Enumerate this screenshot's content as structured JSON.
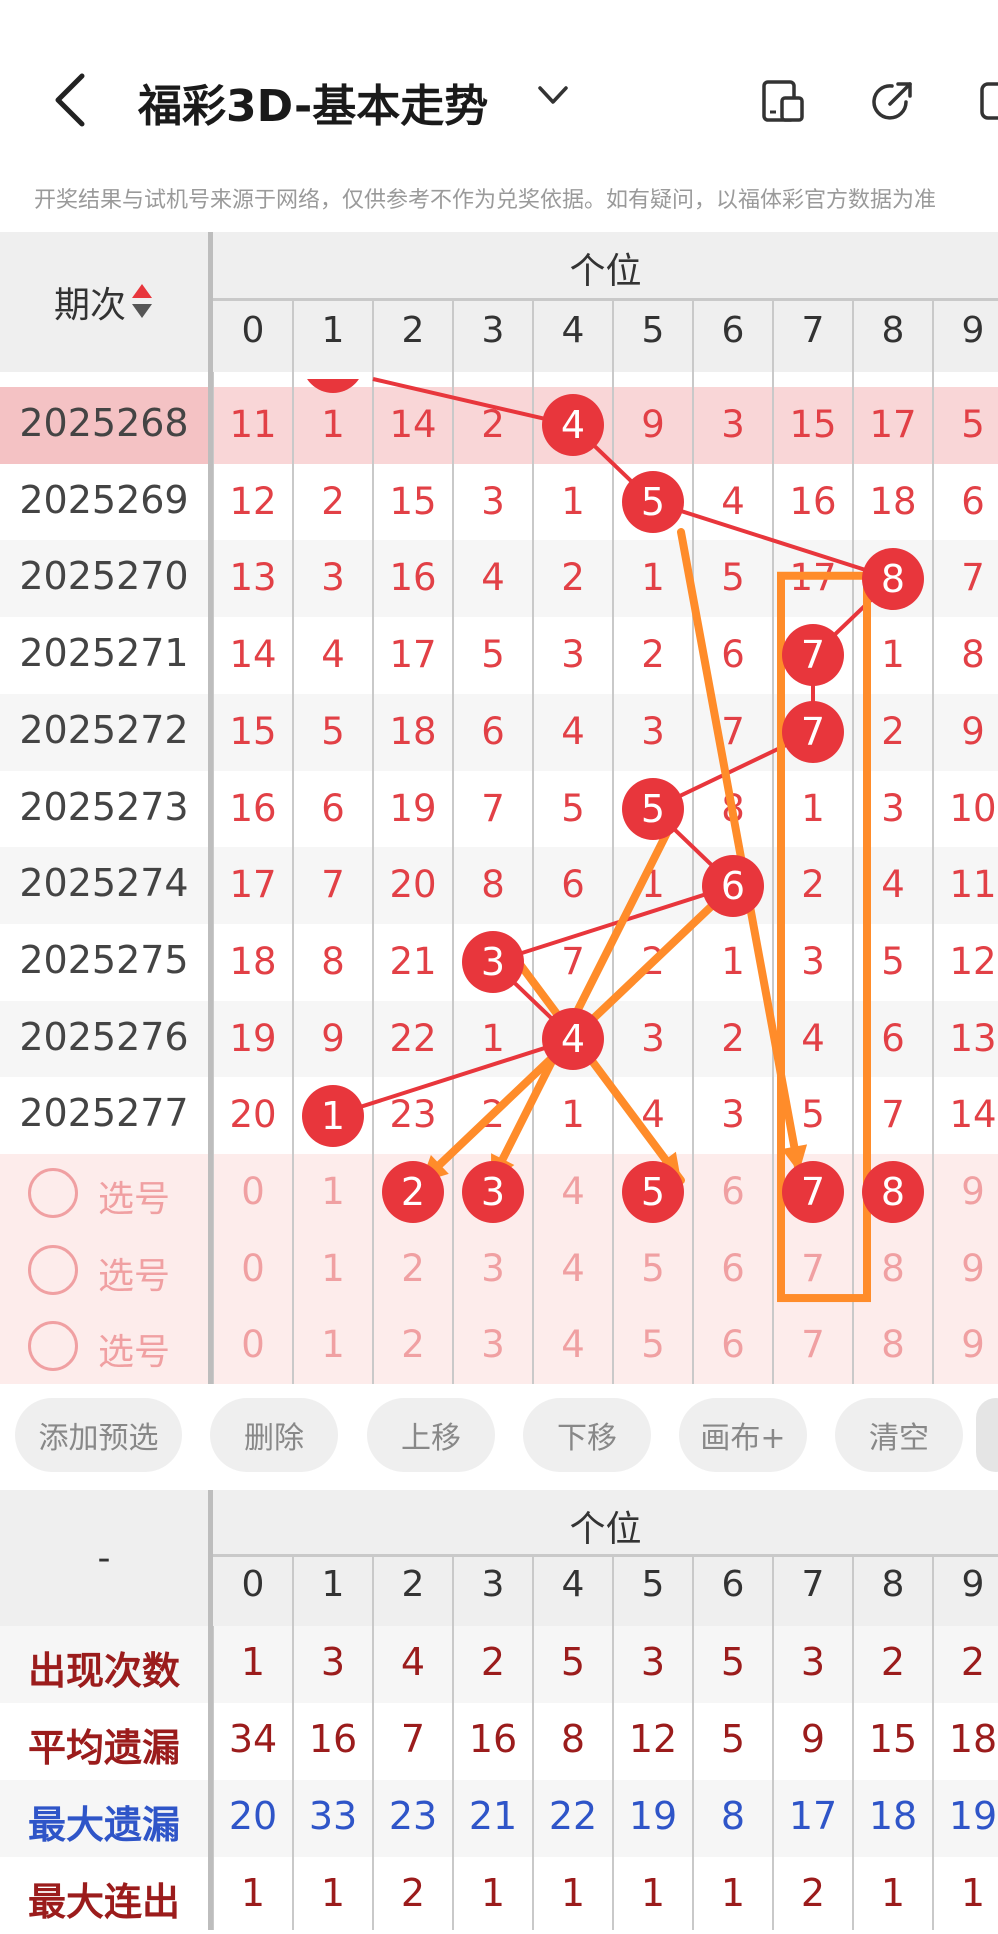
{
  "header": {
    "title": "福彩3D-基本走势"
  },
  "disclaimer": "开奖结果与试机号来源于网络，仅供参考不作为兑奖依据。如有疑问，以福体彩官方数据为准",
  "table_header": {
    "period_label": "期次",
    "group_title": "个位",
    "digits": [
      "0",
      "1",
      "2",
      "3",
      "4",
      "5",
      "6",
      "7",
      "8",
      "9"
    ]
  },
  "rows": [
    {
      "period": "2025268",
      "cells": [
        "11",
        "1",
        "14",
        "2",
        "4",
        "9",
        "3",
        "15",
        "17",
        "5"
      ],
      "hit": 4
    },
    {
      "period": "2025269",
      "cells": [
        "12",
        "2",
        "15",
        "3",
        "1",
        "5",
        "4",
        "16",
        "18",
        "6"
      ],
      "hit": 5
    },
    {
      "period": "2025270",
      "cells": [
        "13",
        "3",
        "16",
        "4",
        "2",
        "1",
        "5",
        "17",
        "8",
        "7"
      ],
      "hit": 8
    },
    {
      "period": "2025271",
      "cells": [
        "14",
        "4",
        "17",
        "5",
        "3",
        "2",
        "6",
        "7",
        "1",
        "8"
      ],
      "hit": 7
    },
    {
      "period": "2025272",
      "cells": [
        "15",
        "5",
        "18",
        "6",
        "4",
        "3",
        "7",
        "7",
        "2",
        "9"
      ],
      "hit": 7
    },
    {
      "period": "2025273",
      "cells": [
        "16",
        "6",
        "19",
        "7",
        "5",
        "5",
        "8",
        "1",
        "3",
        "10"
      ],
      "hit": 5
    },
    {
      "period": "2025274",
      "cells": [
        "17",
        "7",
        "20",
        "8",
        "6",
        "1",
        "6",
        "2",
        "4",
        "11"
      ],
      "hit": 6
    },
    {
      "period": "2025275",
      "cells": [
        "18",
        "8",
        "21",
        "3",
        "7",
        "2",
        "1",
        "3",
        "5",
        "12"
      ],
      "hit": 3
    },
    {
      "period": "2025276",
      "cells": [
        "19",
        "9",
        "22",
        "1",
        "4",
        "3",
        "2",
        "4",
        "6",
        "13"
      ],
      "hit": 4
    },
    {
      "period": "2025277",
      "cells": [
        "20",
        "1",
        "23",
        "2",
        "1",
        "4",
        "3",
        "5",
        "7",
        "14"
      ],
      "hit": 1
    }
  ],
  "pick_rows": [
    {
      "label": "选号",
      "cells": [
        "0",
        "1",
        "2",
        "3",
        "4",
        "5",
        "6",
        "7",
        "8",
        "9"
      ],
      "selected": [
        2,
        3,
        5,
        7,
        8
      ]
    },
    {
      "label": "选号",
      "cells": [
        "0",
        "1",
        "2",
        "3",
        "4",
        "5",
        "6",
        "7",
        "8",
        "9"
      ],
      "selected": []
    },
    {
      "label": "选号",
      "cells": [
        "0",
        "1",
        "2",
        "3",
        "4",
        "5",
        "6",
        "7",
        "8",
        "9"
      ],
      "selected": []
    }
  ],
  "buttons": [
    "添加预选",
    "删除",
    "上移",
    "下移",
    "画布+",
    "清空"
  ],
  "stats_header": {
    "left": "-",
    "group_title": "个位"
  },
  "stats": [
    {
      "label": "出现次数",
      "values": [
        "1",
        "3",
        "4",
        "2",
        "5",
        "3",
        "5",
        "3",
        "2",
        "2"
      ],
      "color": "#9b1c1c"
    },
    {
      "label": "平均遗漏",
      "values": [
        "34",
        "16",
        "7",
        "16",
        "8",
        "12",
        "5",
        "9",
        "15",
        "18"
      ],
      "color": "#9b1c1c"
    },
    {
      "label": "最大遗漏",
      "values": [
        "20",
        "33",
        "23",
        "21",
        "22",
        "19",
        "8",
        "17",
        "18",
        "19"
      ],
      "color": "#2f55c8"
    },
    {
      "label": "最大连出",
      "values": [
        "1",
        "1",
        "2",
        "1",
        "1",
        "1",
        "1",
        "2",
        "1",
        "1"
      ],
      "color": "#9b1c1c"
    }
  ],
  "colors": {
    "hit_ball": "#e8363c",
    "text_red": "#e24046",
    "highlight_row": "#f9d6d7",
    "pick_bg": "#fdeceb",
    "annotation": "#ff8c2a"
  }
}
